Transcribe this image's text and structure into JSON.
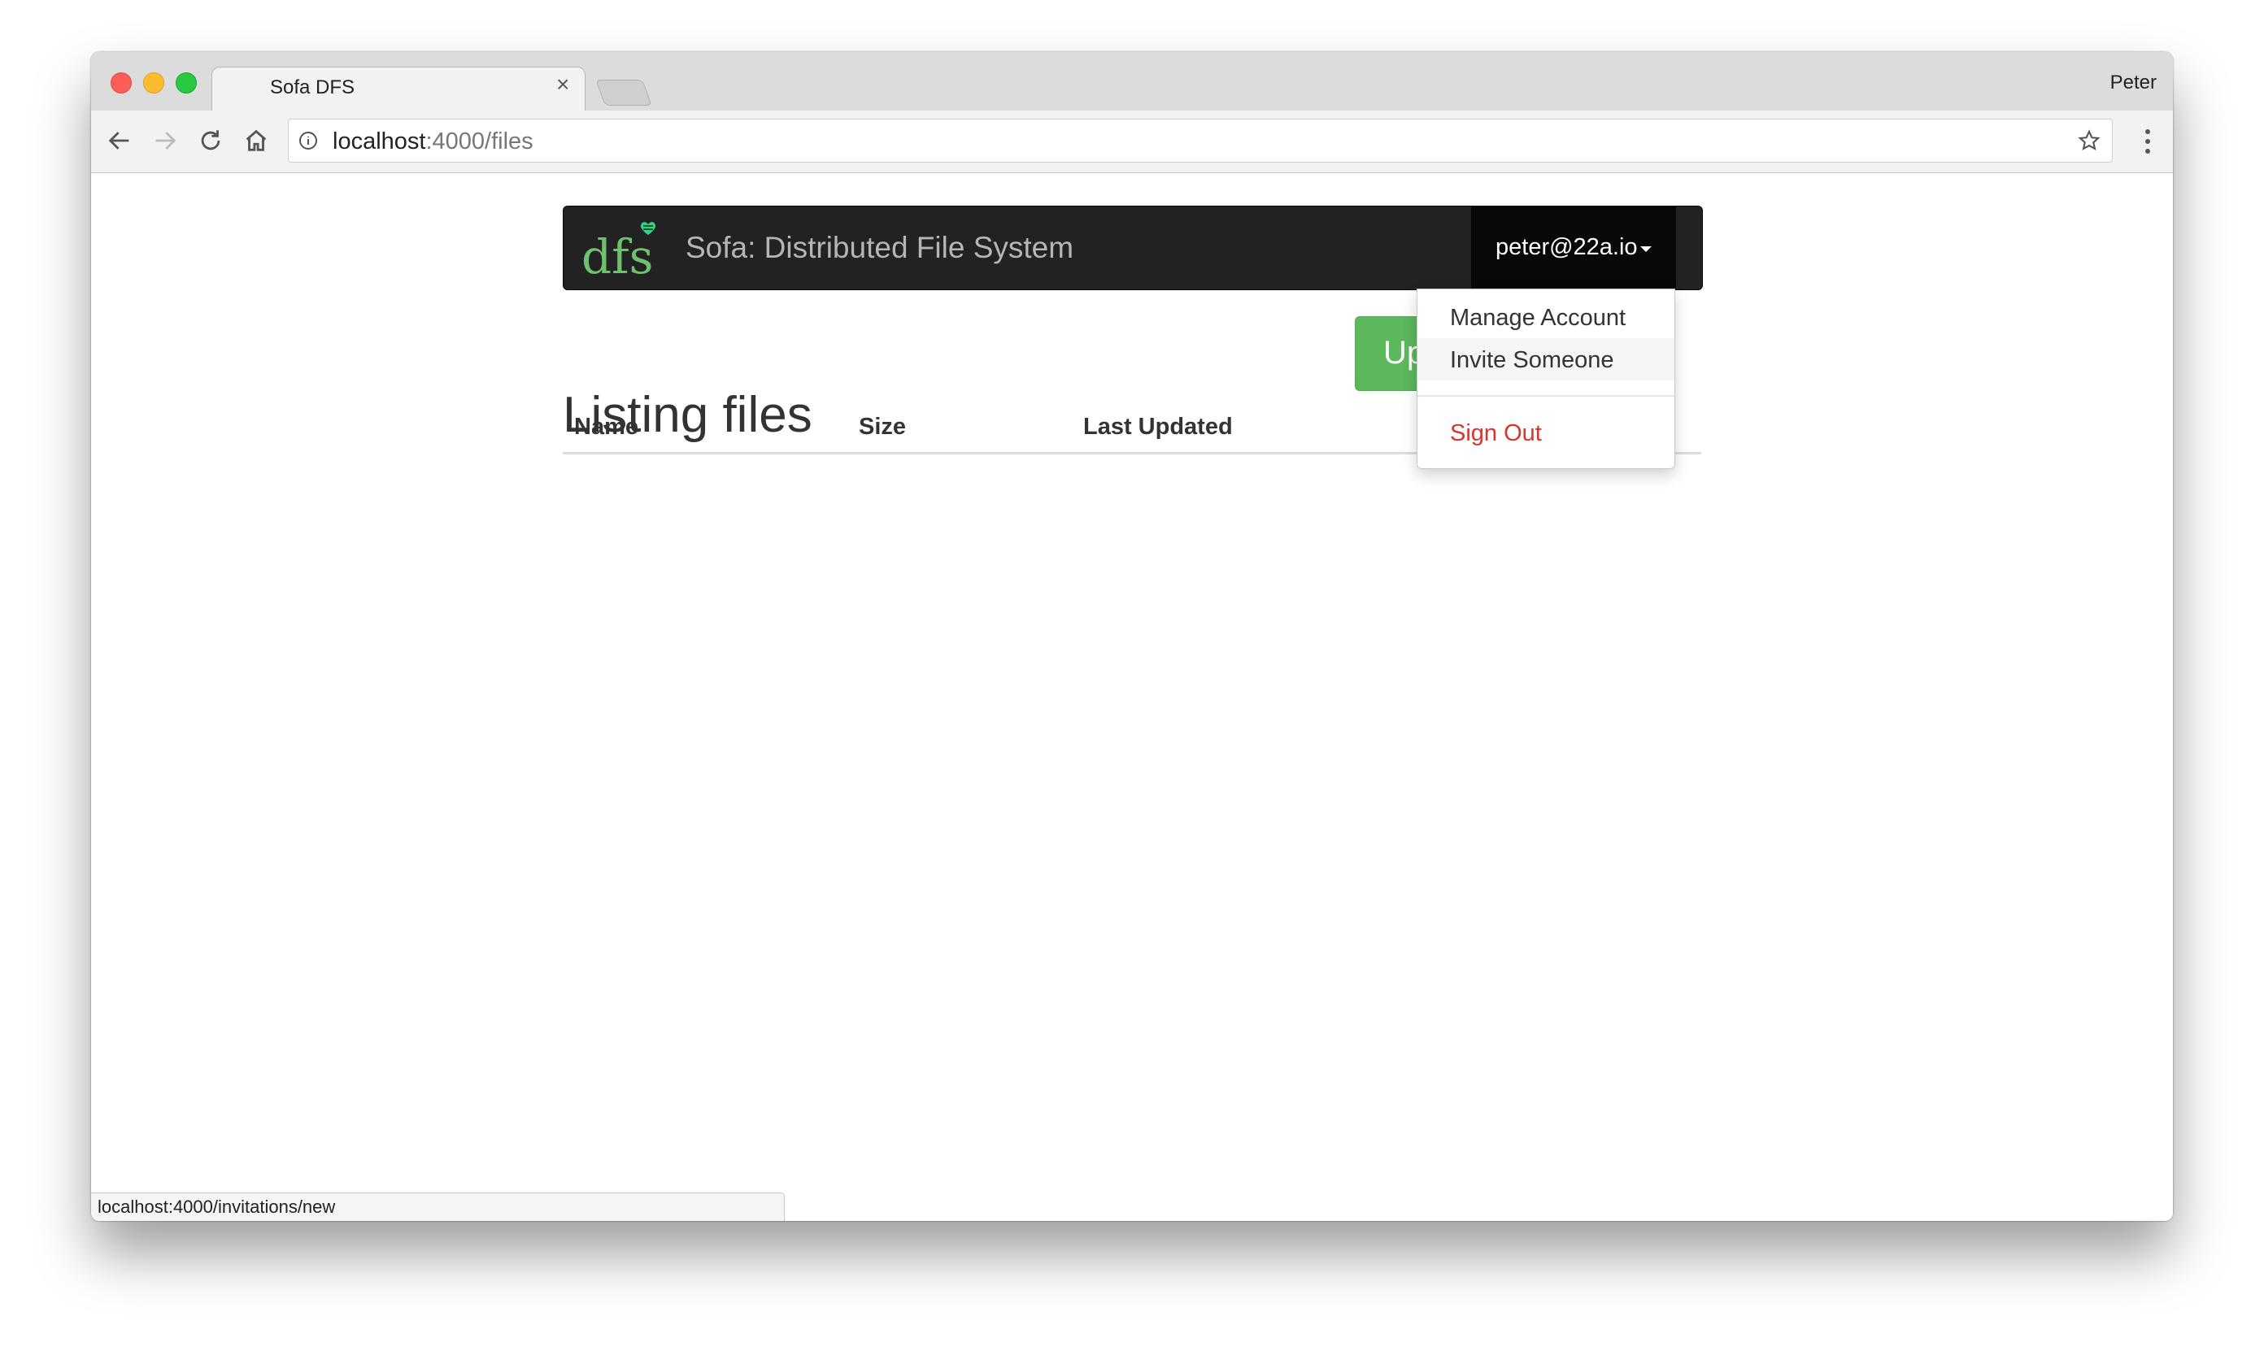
{
  "browser": {
    "tab_title": "Sofa DFS",
    "tab_close": "×",
    "profile_name": "Peter",
    "url_host": "localhost",
    "url_path": ":4000/files",
    "status_url": "localhost:4000/invitations/new"
  },
  "navbar": {
    "logo_text": "dfs",
    "brand": "Sofa: Distributed File System",
    "user_email": "peter@22a.io",
    "colors": {
      "background": "#222222",
      "logo_green": "#6ec16e",
      "logo_heart": "#2fd480"
    }
  },
  "dropdown": {
    "items": [
      {
        "label": "Manage Account"
      },
      {
        "label": "Invite Someone"
      },
      {
        "label": "Sign Out"
      }
    ]
  },
  "main": {
    "heading": "Listing files",
    "upload_button_label": "Upload",
    "table": {
      "columns": [
        "Name",
        "Size",
        "Last Updated"
      ]
    }
  },
  "icons": [
    "back-arrow-icon",
    "forward-arrow-icon",
    "reload-icon",
    "home-icon",
    "info-icon",
    "star-icon",
    "menu-dots-icon",
    "caret-down-icon",
    "close-icon"
  ]
}
